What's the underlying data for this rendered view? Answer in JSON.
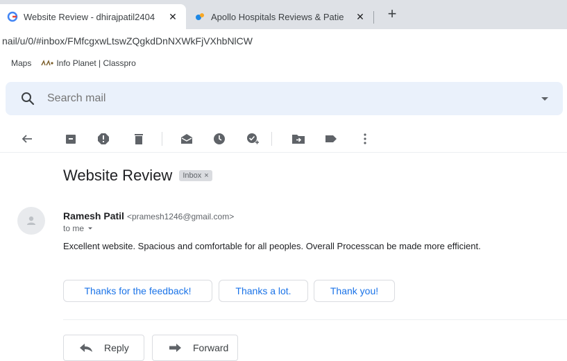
{
  "browser": {
    "tabs": [
      {
        "title": "Website Review - dhirajpatil2404",
        "active": true
      },
      {
        "title": "Apollo Hospitals Reviews & Patie",
        "active": false
      }
    ],
    "close_glyph": "✕",
    "new_tab_glyph": "+",
    "address": "nail/u/0/#inbox/FMfcgxwLtswZQgkdDnNXWkFjVXhbNlCW",
    "bookmarks": [
      "Maps",
      "Info Planet | Classpro"
    ]
  },
  "search": {
    "placeholder": "Search mail"
  },
  "email": {
    "subject": "Website Review",
    "label": "Inbox",
    "label_close": "×",
    "sender_name": "Ramesh Patil",
    "sender_email": "<pramesh1246@gmail.com>",
    "recipient": "to me",
    "body": "Excellent website. Spacious and comfortable for all peoples. Overall Processcan be made more efficient."
  },
  "smart_replies": [
    "Thanks for the feedback!",
    "Thanks a lot.",
    "Thank you!"
  ],
  "actions": {
    "reply": "Reply",
    "forward": "Forward"
  },
  "icons": {
    "toolbar": [
      "back-arrow-icon",
      "archive-icon",
      "report-spam-icon",
      "delete-icon",
      "mark-unread-icon",
      "snooze-icon",
      "add-to-tasks-icon",
      "move-to-icon",
      "label-icon",
      "more-vert-icon"
    ]
  },
  "colors": {
    "accent": "#1a73e8",
    "search_bg": "#eaf1fb",
    "icon": "#5f6368"
  }
}
